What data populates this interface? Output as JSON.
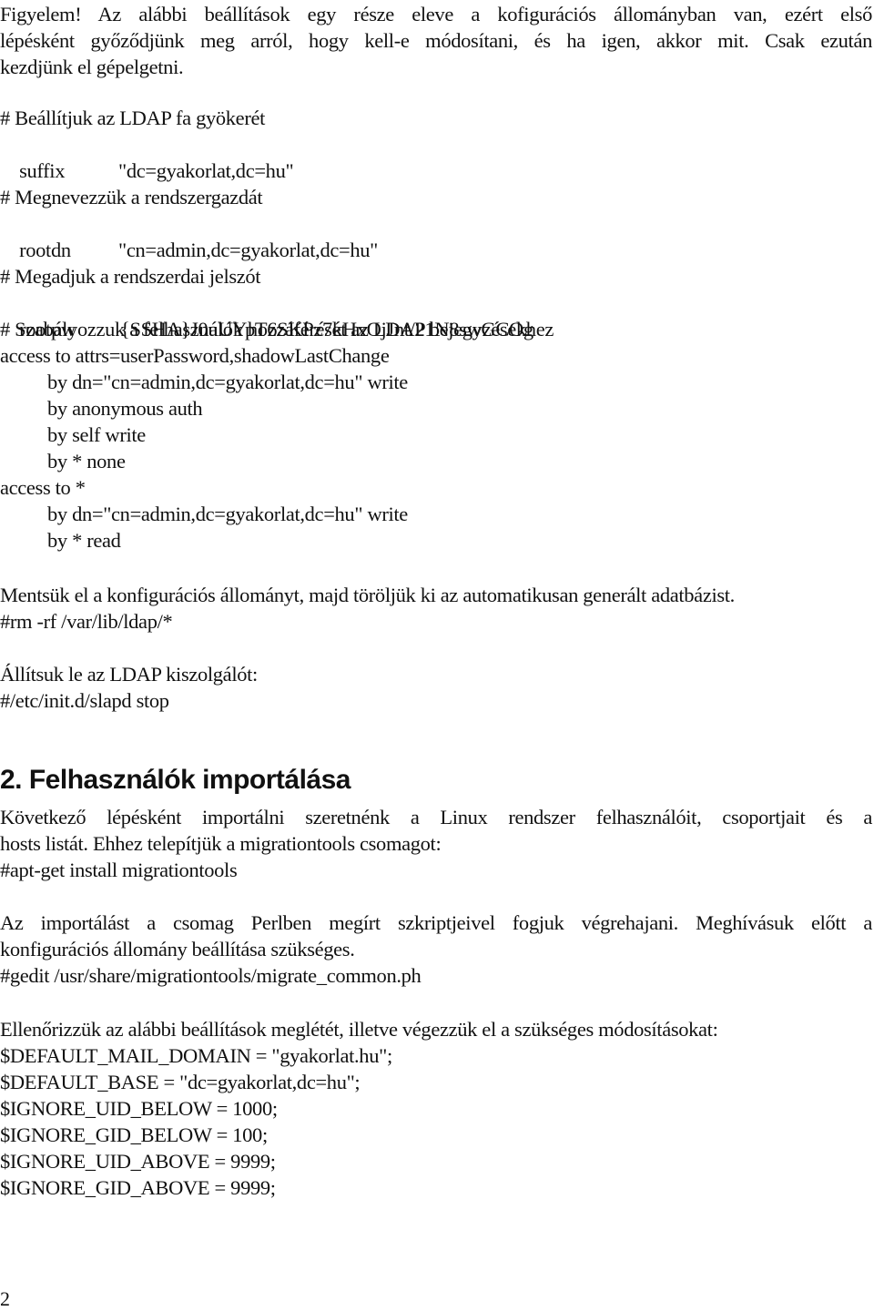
{
  "intro": {
    "line1": "Figyelem! Az alábbi beállítások egy része eleve a kofigurációs állományban van, ezért első",
    "line2": "lépésként győződjünk meg arról, hogy kell-e módosítani, és ha igen, akkor mit. Csak ezután",
    "line3": "kezdjünk el gépelgetni."
  },
  "config": {
    "comment_suffix": "# Beállítjuk az LDAP fa gyökerét",
    "suffix_key": "suffix",
    "suffix_value": "\"dc=gyakorlat,dc=hu\"",
    "comment_rootdn": "# Megnevezzük a rendszergazdát",
    "rootdn_key": "rootdn",
    "rootdn_value": "\"cn=admin,dc=gyakorlat,dc=hu\"",
    "comment_rootpw": "# Megadjuk a rendszerdai jelszót",
    "rootpw_key": "rootpw",
    "rootpw_value": "{SSHA}J0uUYpT6SKPz7kHxOjJnt/21N8swGCOg",
    "comment_access": "# Szabályozzuk a felhasználók hozzáférését az LDAP bejegyzésekhez",
    "access1": "access to attrs=userPassword,shadowLastChange",
    "access1_rules": [
      "by dn=\"cn=admin,dc=gyakorlat,dc=hu\" write",
      "by anonymous auth",
      "by self write",
      "by * none"
    ],
    "access2": "access to *",
    "access2_rules": [
      "by dn=\"cn=admin,dc=gyakorlat,dc=hu\" write",
      "by * read"
    ]
  },
  "save_step": {
    "text": "Mentsük el a konfigurációs állományt, majd töröljük ki az automatikusan generált adatbázist.",
    "command": "#rm -rf /var/lib/ldap/*"
  },
  "stop_step": {
    "text": "Állítsuk le az LDAP kiszolgálót:",
    "command": "#/etc/init.d/slapd stop"
  },
  "section2": {
    "heading": "2. Felhasználók importálása",
    "para1_line1": "Következő lépésként importálni szeretnénk a Linux rendszer felhasználóit, csoportjait és a",
    "para1_line2": "hosts listát. Ehhez telepítjük a migrationtools csomagot:",
    "install_command": "#apt-get install migrationtools",
    "para2_line1": "Az importálást a csomag Perlben megírt szkriptjeivel fogjuk végrehajani. Meghívásuk előtt a",
    "para2_line2": "konfigurációs állomány beállítása szükséges.",
    "edit_command": "#gedit /usr/share/migrationtools/migrate_common.ph",
    "para3": "Ellenőrizzük az alábbi beállítások meglétét, illetve végezzük el a szükséges módosításokat:",
    "settings": [
      "$DEFAULT_MAIL_DOMAIN = \"gyakorlat.hu\";",
      "$DEFAULT_BASE = \"dc=gyakorlat,dc=hu\";",
      "$IGNORE_UID_BELOW = 1000;",
      "$IGNORE_GID_BELOW = 100;",
      "$IGNORE_UID_ABOVE = 9999;",
      "$IGNORE_GID_ABOVE = 9999;"
    ]
  },
  "page_number": "2"
}
